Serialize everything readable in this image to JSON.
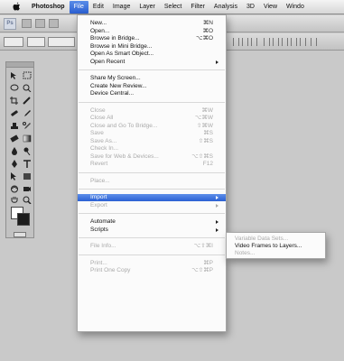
{
  "menubar": {
    "apple_icon": "apple-logo-icon",
    "items": [
      {
        "label": "Photoshop",
        "active": false
      },
      {
        "label": "File",
        "active": true
      },
      {
        "label": "Edit",
        "active": false
      },
      {
        "label": "Image",
        "active": false
      },
      {
        "label": "Layer",
        "active": false
      },
      {
        "label": "Select",
        "active": false
      },
      {
        "label": "Filter",
        "active": false
      },
      {
        "label": "Analysis",
        "active": false
      },
      {
        "label": "3D",
        "active": false
      },
      {
        "label": "View",
        "active": false
      },
      {
        "label": "Windo",
        "active": false
      }
    ]
  },
  "appbar": {
    "logo_text": "Ps"
  },
  "file_menu": {
    "groups": [
      [
        {
          "label": "New...",
          "shortcut": "⌘N",
          "enabled": true
        },
        {
          "label": "Open...",
          "shortcut": "⌘O",
          "enabled": true
        },
        {
          "label": "Browse in Bridge...",
          "shortcut": "⌥⌘O",
          "enabled": true
        },
        {
          "label": "Browse in Mini Bridge...",
          "shortcut": "",
          "enabled": true
        },
        {
          "label": "Open As Smart Object...",
          "shortcut": "",
          "enabled": true
        },
        {
          "label": "Open Recent",
          "shortcut": "",
          "enabled": true,
          "submenu": true
        }
      ],
      [
        {
          "label": "Share My Screen...",
          "shortcut": "",
          "enabled": true
        },
        {
          "label": "Create New Review...",
          "shortcut": "",
          "enabled": true
        },
        {
          "label": "Device Central...",
          "shortcut": "",
          "enabled": true
        }
      ],
      [
        {
          "label": "Close",
          "shortcut": "⌘W",
          "enabled": false
        },
        {
          "label": "Close All",
          "shortcut": "⌥⌘W",
          "enabled": false
        },
        {
          "label": "Close and Go To Bridge...",
          "shortcut": "⇧⌘W",
          "enabled": false
        },
        {
          "label": "Save",
          "shortcut": "⌘S",
          "enabled": false
        },
        {
          "label": "Save As...",
          "shortcut": "⇧⌘S",
          "enabled": false
        },
        {
          "label": "Check In...",
          "shortcut": "",
          "enabled": false
        },
        {
          "label": "Save for Web & Devices...",
          "shortcut": "⌥⇧⌘S",
          "enabled": false
        },
        {
          "label": "Revert",
          "shortcut": "F12",
          "enabled": false
        }
      ],
      [
        {
          "label": "Place...",
          "shortcut": "",
          "enabled": false
        }
      ],
      [
        {
          "label": "Import",
          "shortcut": "",
          "enabled": true,
          "submenu": true,
          "highlighted": true
        },
        {
          "label": "Export",
          "shortcut": "",
          "enabled": false,
          "submenu": true
        }
      ],
      [
        {
          "label": "Automate",
          "shortcut": "",
          "enabled": true,
          "submenu": true
        },
        {
          "label": "Scripts",
          "shortcut": "",
          "enabled": true,
          "submenu": true
        }
      ],
      [
        {
          "label": "File Info...",
          "shortcut": "⌥⇧⌘I",
          "enabled": false
        }
      ],
      [
        {
          "label": "Print...",
          "shortcut": "⌘P",
          "enabled": false
        },
        {
          "label": "Print One Copy",
          "shortcut": "⌥⇧⌘P",
          "enabled": false
        }
      ]
    ]
  },
  "import_submenu": {
    "items": [
      {
        "label": "Variable Data Sets...",
        "enabled": false
      },
      {
        "label": "Video Frames to Layers...",
        "enabled": true
      },
      {
        "label": "Notes...",
        "enabled": false
      }
    ]
  },
  "colors": {
    "highlight": "#2b60d3",
    "menu_bg": "#fbfbfb",
    "workspace_bg": "#c9c9c9",
    "disabled_text": "#aaaaaa"
  }
}
